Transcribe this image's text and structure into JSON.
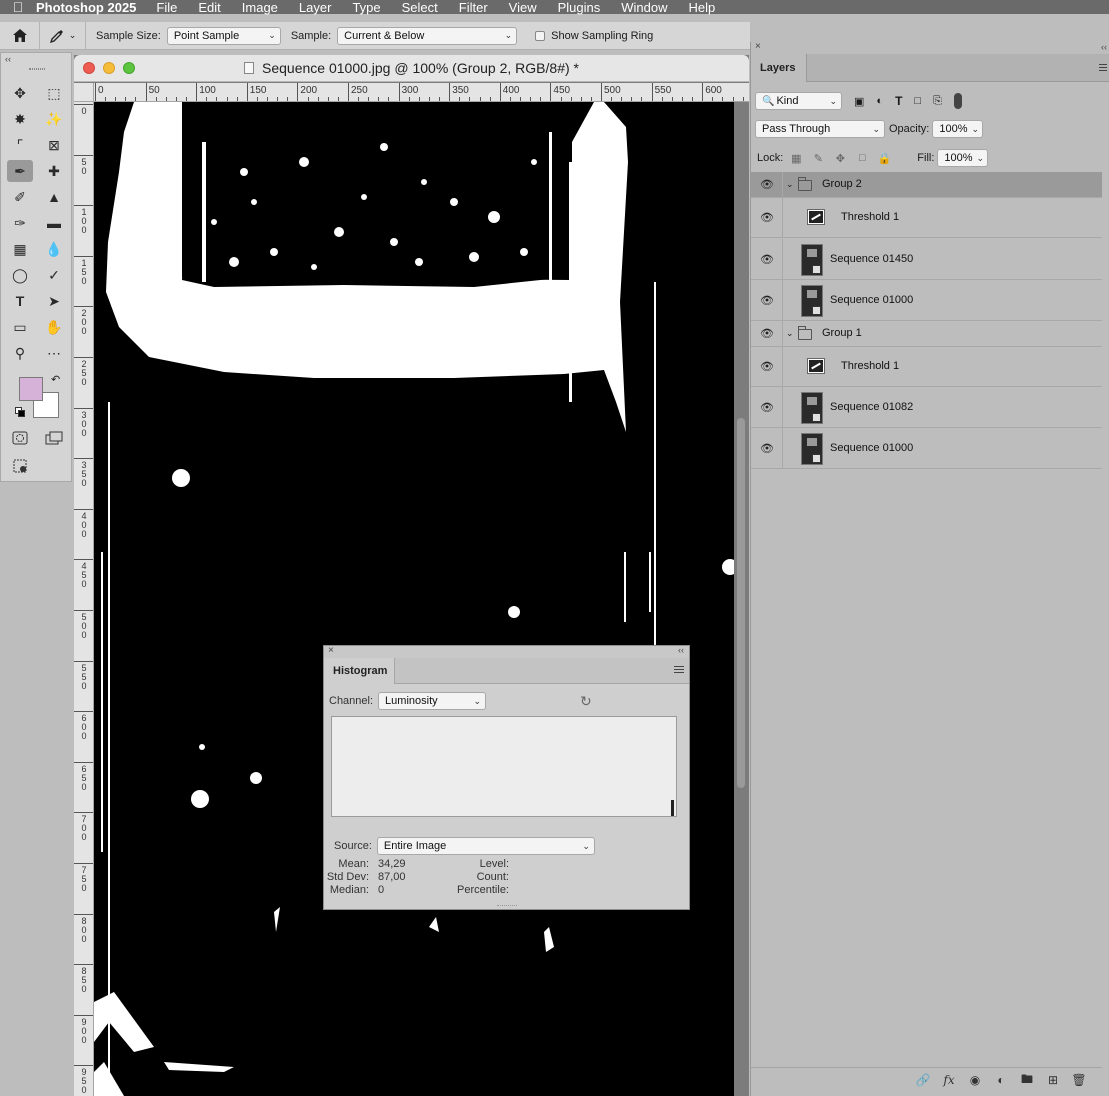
{
  "menubar": {
    "app_name": "Photoshop 2025",
    "items": [
      "File",
      "Edit",
      "Image",
      "Layer",
      "Type",
      "Select",
      "Filter",
      "View",
      "Plugins",
      "Window",
      "Help"
    ]
  },
  "options_bar": {
    "sample_size_label": "Sample Size:",
    "sample_size_value": "Point Sample",
    "sample_label": "Sample:",
    "sample_value": "Current & Below",
    "show_sampling_ring_label": "Show Sampling Ring",
    "show_sampling_ring_checked": false
  },
  "toolbar": {
    "foreground_color": "#d6b2d8",
    "background_color": "#ffffff",
    "tools": [
      [
        "move-tool-icon",
        "rect-marquee-icon"
      ],
      [
        "polygon-lasso-icon",
        "magic-wand-icon"
      ],
      [
        "crop-icon",
        "frame-icon"
      ],
      [
        "eyedropper-icon",
        "healing-brush-icon"
      ],
      [
        "brush-icon",
        "clone-stamp-icon"
      ],
      [
        "history-brush-icon",
        "eraser-icon"
      ],
      [
        "gradient-icon",
        "blur-icon"
      ],
      [
        "dodge-icon",
        "pen-icon"
      ],
      [
        "type-icon",
        "path-select-icon"
      ],
      [
        "rectangle-icon",
        "hand-icon"
      ],
      [
        "zoom-icon",
        "more-tools-icon"
      ]
    ],
    "active_tool": "eyedropper-icon"
  },
  "document": {
    "title": "Sequence 01000.jpg @ 100% (Group 2, RGB/8#) *",
    "hruler_labels": [
      "0",
      "50",
      "100",
      "150",
      "200",
      "250",
      "300",
      "350",
      "400",
      "450",
      "500",
      "550",
      "600"
    ],
    "vruler_labels": [
      "0",
      "50",
      "100",
      "150",
      "200",
      "250",
      "300",
      "350",
      "400",
      "450",
      "500",
      "550",
      "600",
      "650",
      "700",
      "750",
      "800",
      "850",
      "900",
      "950"
    ]
  },
  "histogram": {
    "tab": "Histogram",
    "channel_label": "Channel:",
    "channel_value": "Luminosity",
    "source_label": "Source:",
    "source_value": "Entire Image",
    "mean_label": "Mean:",
    "mean_value": "34,29",
    "stddev_label": "Std Dev:",
    "stddev_value": "87,00",
    "median_label": "Median:",
    "median_value": "0",
    "level_label": "Level:",
    "count_label": "Count:",
    "percentile_label": "Percentile:"
  },
  "layers": {
    "tab": "Layers",
    "filter_value": "Kind",
    "blend_mode": "Pass Through",
    "opacity_label": "Opacity:",
    "opacity_value": "100%",
    "lock_label": "Lock:",
    "fill_label": "Fill:",
    "fill_value": "100%",
    "items": [
      {
        "name": "Group 2",
        "kind": "group",
        "selected": true
      },
      {
        "name": "Threshold 1",
        "kind": "adjustment",
        "selected": false
      },
      {
        "name": "Sequence 01450",
        "kind": "smart",
        "selected": false
      },
      {
        "name": "Sequence 01000",
        "kind": "smart",
        "selected": false
      },
      {
        "name": "Group 1",
        "kind": "group",
        "selected": false
      },
      {
        "name": "Threshold 1",
        "kind": "adjustment",
        "selected": false
      },
      {
        "name": "Sequence 01082",
        "kind": "smart",
        "selected": false
      },
      {
        "name": "Sequence 01000",
        "kind": "smart",
        "selected": false
      }
    ]
  }
}
